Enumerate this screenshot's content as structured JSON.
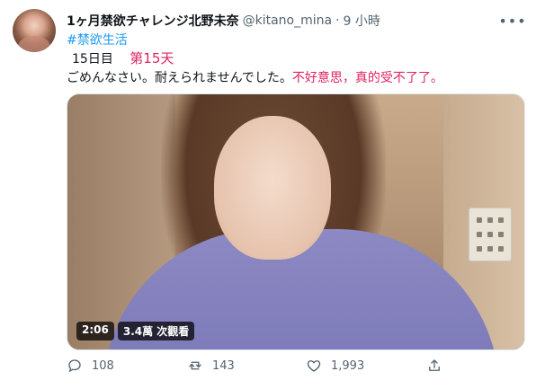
{
  "tweet": {
    "display_name": "1ヶ月禁欲チャレンジ北野未奈",
    "handle": "@kitano_mina",
    "separator": "·",
    "time": "9 小時",
    "hashtag": "#禁欲生活",
    "day_label": "15日目",
    "day_label_cn": "第15天",
    "text_jp": "ごめんなさい。耐えられませんでした。",
    "text_cn": "不好意思，真的受不了了。"
  },
  "media": {
    "duration": "2:06",
    "views": "3.4萬 次觀看"
  },
  "actions": {
    "replies": "108",
    "retweets": "143",
    "likes": "1,993"
  },
  "icons": {
    "more": "more-icon",
    "reply": "reply-icon",
    "retweet": "retweet-icon",
    "like": "heart-icon",
    "share": "share-icon"
  },
  "colors": {
    "link": "#1d9bf0",
    "annotation_red": "#e0245e",
    "muted": "#536471"
  }
}
